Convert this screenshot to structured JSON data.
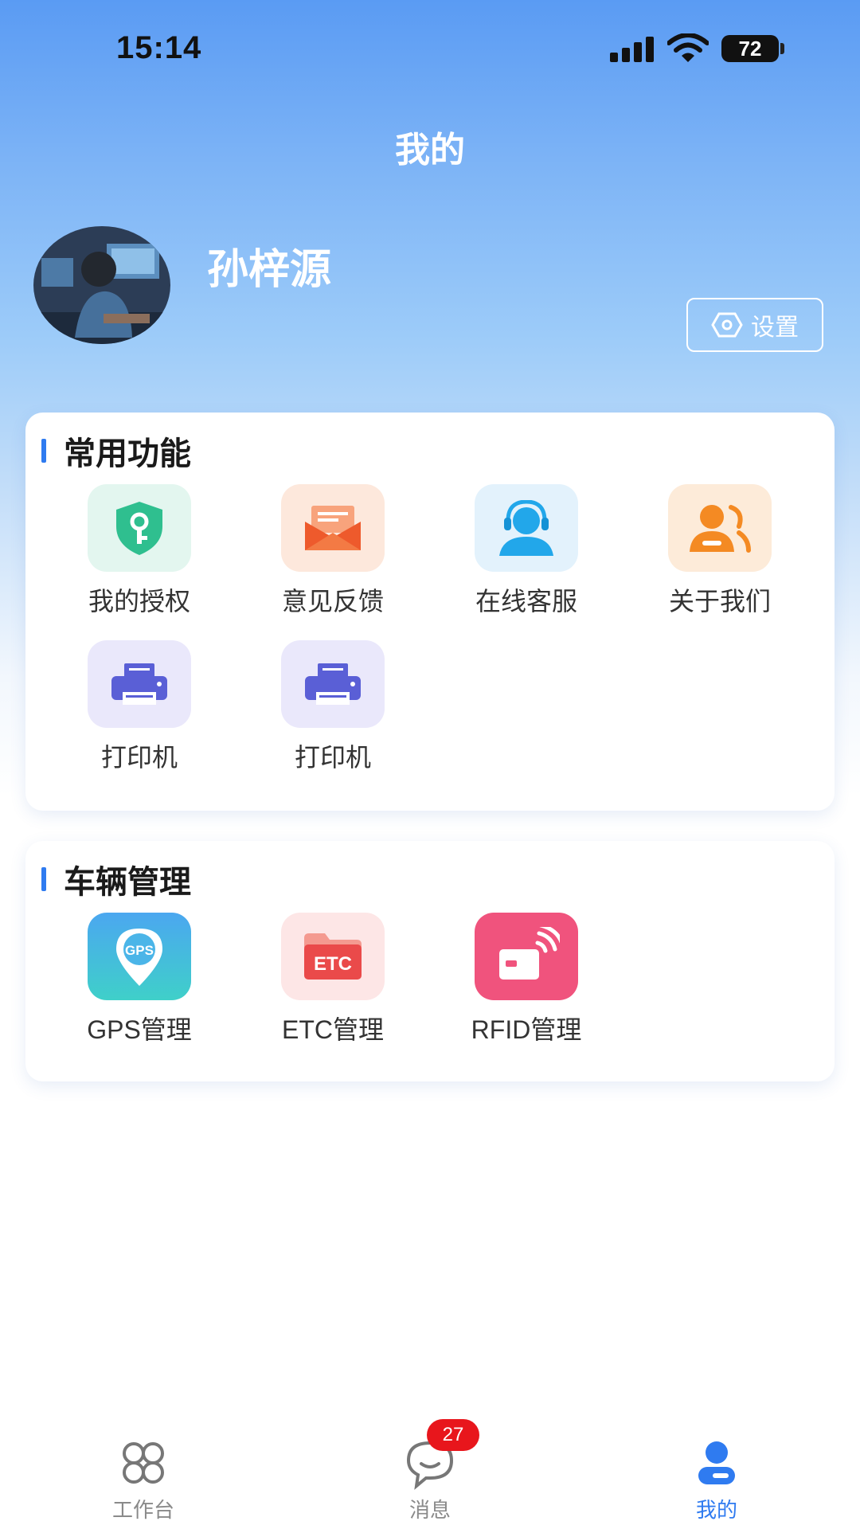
{
  "status_bar": {
    "time": "15:14",
    "battery": "72"
  },
  "header": {
    "title": "我的"
  },
  "profile": {
    "name": "孙梓源",
    "settings_label": "设置"
  },
  "common_functions": {
    "title": "常用功能",
    "items": [
      {
        "label": "我的授权",
        "icon": "shield-key-icon"
      },
      {
        "label": "意见反馈",
        "icon": "envelope-icon"
      },
      {
        "label": "在线客服",
        "icon": "headset-agent-icon"
      },
      {
        "label": "关于我们",
        "icon": "people-icon"
      },
      {
        "label": "打印机",
        "icon": "printer-icon"
      },
      {
        "label": "打印机",
        "icon": "printer-icon"
      }
    ]
  },
  "vehicle_management": {
    "title": "车辆管理",
    "items": [
      {
        "label": "GPS管理",
        "icon": "gps-pin-icon",
        "icon_text": "GPS"
      },
      {
        "label": "ETC管理",
        "icon": "etc-folder-icon",
        "icon_text": "ETC"
      },
      {
        "label": "RFID管理",
        "icon": "rfid-card-icon"
      }
    ]
  },
  "bottom_nav": {
    "items": [
      {
        "label": "工作台",
        "icon": "workbench-icon",
        "active": false
      },
      {
        "label": "消息",
        "icon": "chat-icon",
        "active": false,
        "badge": "27"
      },
      {
        "label": "我的",
        "icon": "user-icon",
        "active": true
      }
    ]
  },
  "colors": {
    "accent": "#2f7bf0",
    "badge": "#e8161c"
  }
}
